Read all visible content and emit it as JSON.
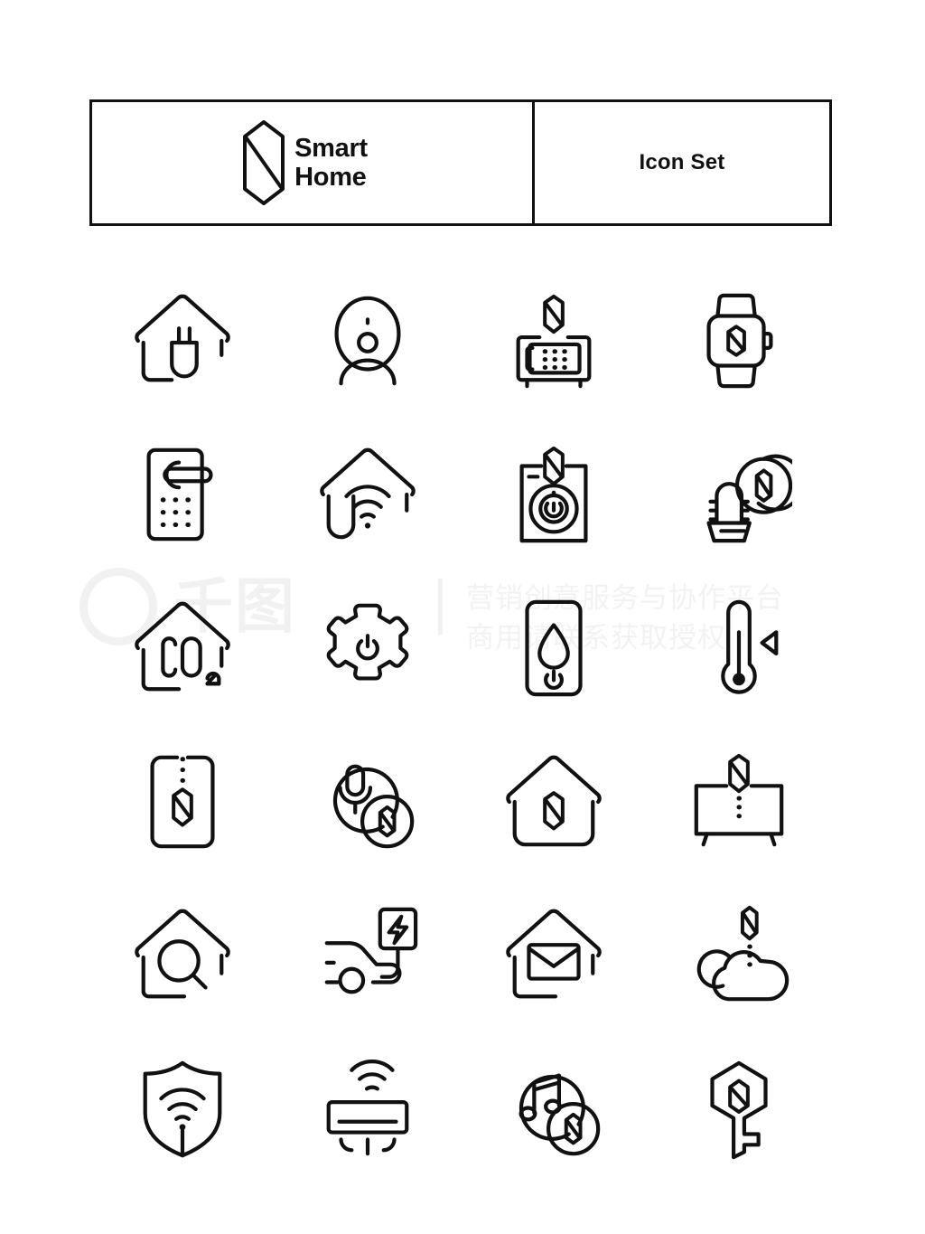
{
  "header": {
    "brand_line1": "Smart",
    "brand_line2": "Home",
    "brand_logo_icon": "smart-home-hexagon-logo-icon",
    "title": "Icon Set"
  },
  "watermark": {
    "logo_text": "千图",
    "line1": "营销创意服务与协作平台",
    "line2": "商用请联系获取授权",
    "color": "#f1f1f1"
  },
  "style": {
    "stroke_color": "#111111",
    "background": "#ffffff"
  },
  "icons": [
    {
      "row": 1,
      "col": 1,
      "name": "house-power-plug-icon",
      "label": "Smart Home Power"
    },
    {
      "row": 1,
      "col": 2,
      "name": "smart-speaker-icon",
      "label": "Smart Speaker"
    },
    {
      "row": 1,
      "col": 3,
      "name": "smart-safe-keypad-icon",
      "label": "Smart Safe"
    },
    {
      "row": 1,
      "col": 4,
      "name": "smart-watch-icon",
      "label": "Smart Watch"
    },
    {
      "row": 2,
      "col": 1,
      "name": "smart-door-lock-icon",
      "label": "Smart Door Lock"
    },
    {
      "row": 2,
      "col": 2,
      "name": "house-wifi-icon",
      "label": "Home Wi-Fi"
    },
    {
      "row": 2,
      "col": 3,
      "name": "smart-power-switch-icon",
      "label": "Smart Power Switch"
    },
    {
      "row": 2,
      "col": 4,
      "name": "smart-plant-sensor-icon",
      "label": "Plant Sensor"
    },
    {
      "row": 3,
      "col": 1,
      "name": "house-co2-sensor-icon",
      "label": "CO2 Sensor"
    },
    {
      "row": 3,
      "col": 2,
      "name": "gear-power-settings-icon",
      "label": "Automation Settings"
    },
    {
      "row": 3,
      "col": 3,
      "name": "humidity-control-panel-icon",
      "label": "Humidity Control"
    },
    {
      "row": 3,
      "col": 4,
      "name": "thermometer-icon",
      "label": "Thermostat"
    },
    {
      "row": 4,
      "col": 1,
      "name": "smart-phone-control-icon",
      "label": "Phone Control"
    },
    {
      "row": 4,
      "col": 2,
      "name": "voice-assistant-icon",
      "label": "Voice Assistant"
    },
    {
      "row": 4,
      "col": 3,
      "name": "smart-house-hub-icon",
      "label": "Smart Home Hub"
    },
    {
      "row": 4,
      "col": 4,
      "name": "smart-tv-icon",
      "label": "Smart TV"
    },
    {
      "row": 5,
      "col": 1,
      "name": "house-search-icon",
      "label": "Home Search"
    },
    {
      "row": 5,
      "col": 2,
      "name": "ev-charging-car-icon",
      "label": "EV Charging"
    },
    {
      "row": 5,
      "col": 3,
      "name": "house-mail-icon",
      "label": "Home Mail"
    },
    {
      "row": 5,
      "col": 4,
      "name": "cloud-connect-icon",
      "label": "Cloud Connect"
    },
    {
      "row": 6,
      "col": 1,
      "name": "shield-wifi-security-icon",
      "label": "Network Security"
    },
    {
      "row": 6,
      "col": 2,
      "name": "smart-air-conditioner-icon",
      "label": "Smart Air Conditioner"
    },
    {
      "row": 6,
      "col": 3,
      "name": "smart-music-icon",
      "label": "Smart Music"
    },
    {
      "row": 6,
      "col": 4,
      "name": "smart-key-icon",
      "label": "Smart Key"
    }
  ]
}
